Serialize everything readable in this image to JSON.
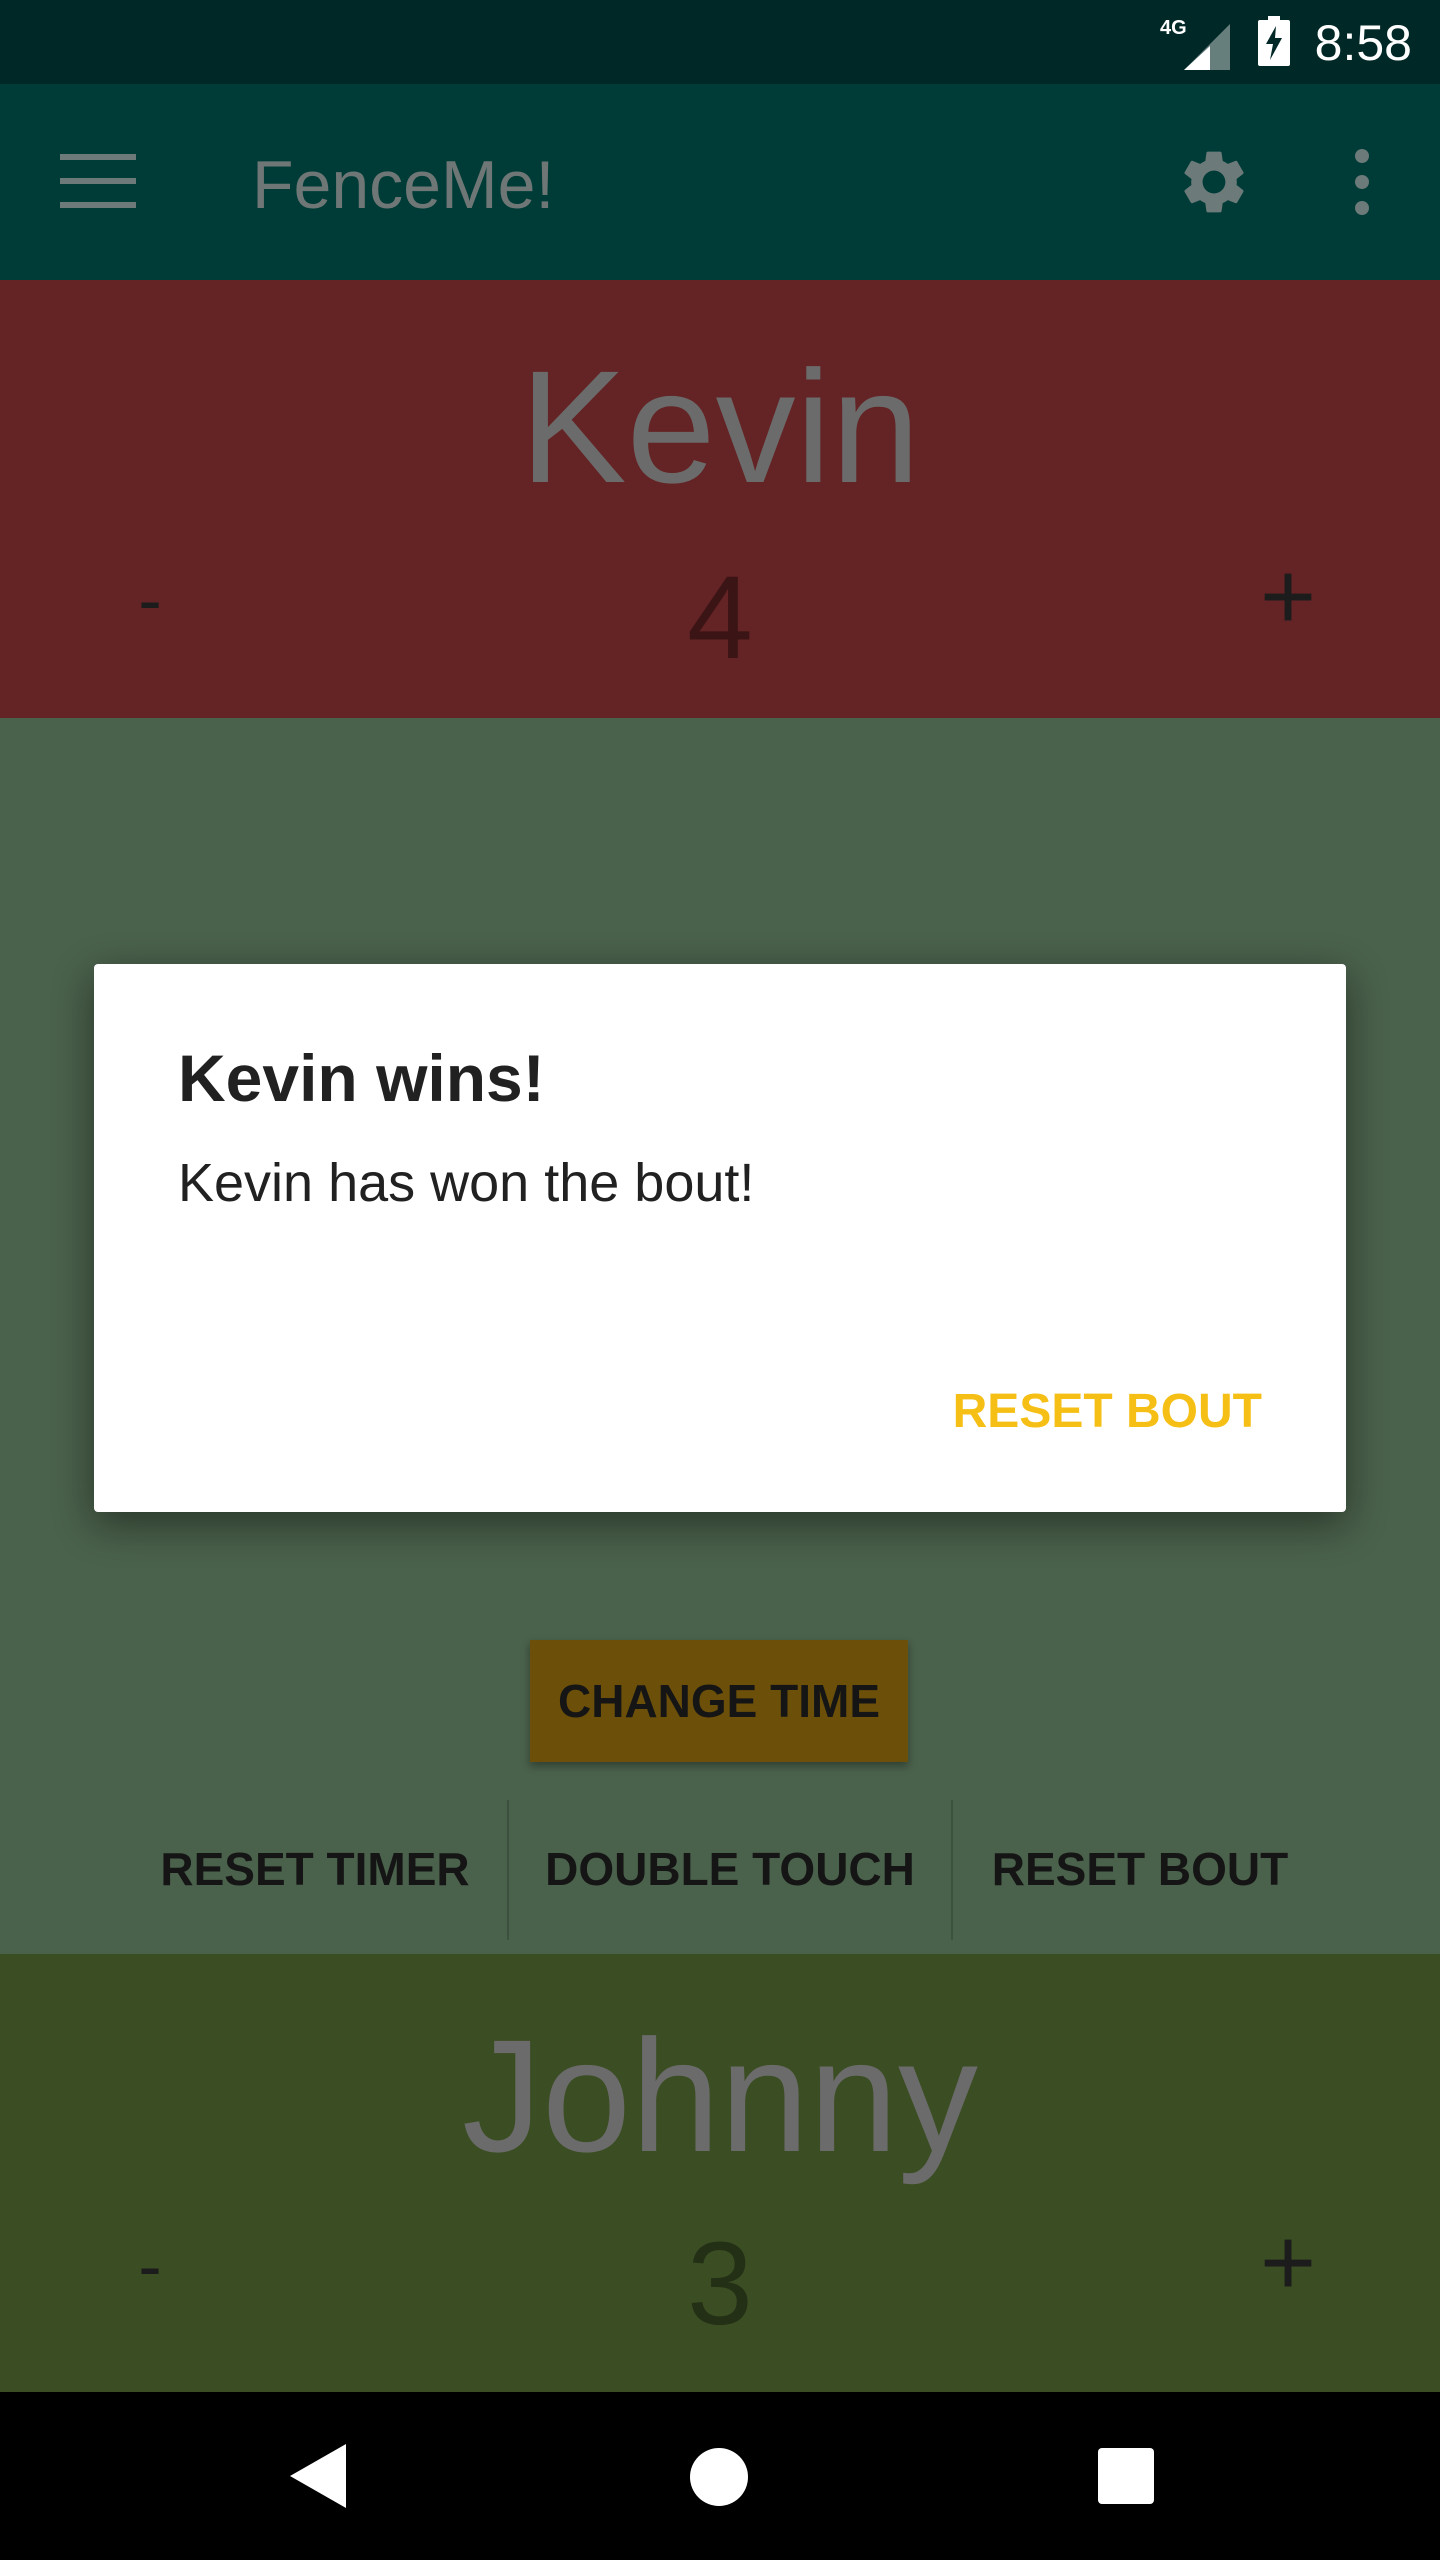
{
  "status_bar": {
    "time": "8:58",
    "network": "4G",
    "icons": [
      "signal-icon",
      "battery-charging-icon"
    ]
  },
  "app_bar": {
    "title": "FenceMe!",
    "icons": [
      "menu-icon",
      "gear-icon",
      "overflow-menu-icon"
    ]
  },
  "fencer_top": {
    "name": "Kevin",
    "score": "4",
    "minus_label": "-",
    "plus_label": "+",
    "color": "#642324"
  },
  "middle": {
    "change_time_label": "CHANGE TIME",
    "actions": [
      "RESET TIMER",
      "DOUBLE TOUCH",
      "RESET BOUT"
    ],
    "color": "#4a614b"
  },
  "fencer_bottom": {
    "name": "Johnny",
    "score": "3",
    "minus_label": "-",
    "plus_label": "+",
    "color": "#3b4d22"
  },
  "dialog": {
    "title": "Kevin wins!",
    "message": "Kevin has won the bout!",
    "action_label": "RESET BOUT",
    "accent_color": "#f5bf15"
  },
  "nav_bar": {
    "icons": [
      "back-icon",
      "home-icon",
      "recents-icon"
    ]
  }
}
